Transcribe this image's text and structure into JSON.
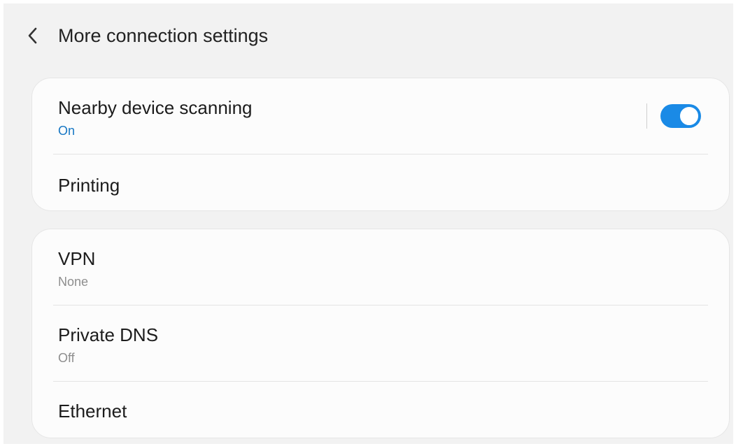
{
  "header": {
    "title": "More connection settings",
    "back_icon": "chevron-left-icon"
  },
  "colors": {
    "accent": "#1a8ae6",
    "status_on": "#1777c4",
    "status_off": "#8e8e8e",
    "background": "#f2f2f2",
    "card": "#fcfcfc"
  },
  "group1": {
    "nearby": {
      "label": "Nearby device scanning",
      "status": "On",
      "toggle_on": true
    },
    "printing": {
      "label": "Printing"
    }
  },
  "group2": {
    "vpn": {
      "label": "VPN",
      "status": "None"
    },
    "private_dns": {
      "label": "Private DNS",
      "status": "Off"
    },
    "ethernet": {
      "label": "Ethernet"
    }
  }
}
